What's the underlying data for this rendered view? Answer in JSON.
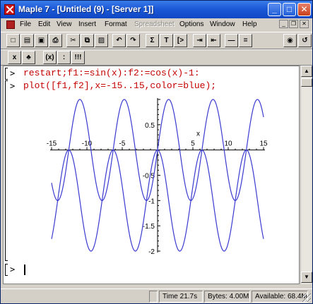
{
  "window": {
    "title": "Maple 7 - [Untitled (9) - [Server 1]]"
  },
  "menu": [
    {
      "label": "File",
      "disabled": false
    },
    {
      "label": "Edit",
      "disabled": false
    },
    {
      "label": "View",
      "disabled": false
    },
    {
      "label": "Insert",
      "disabled": false
    },
    {
      "label": "Format",
      "disabled": false
    },
    {
      "label": "Spreadsheet",
      "disabled": true
    },
    {
      "label": "Options",
      "disabled": false
    },
    {
      "label": "Window",
      "disabled": false
    },
    {
      "label": "Help",
      "disabled": false
    }
  ],
  "toolbar1": [
    {
      "name": "new-document-icon",
      "glyph": "□"
    },
    {
      "name": "open-folder-icon",
      "glyph": "▤"
    },
    {
      "name": "save-icon",
      "glyph": "▣"
    },
    {
      "name": "print-icon",
      "glyph": "⎙"
    },
    {
      "name": "cut-icon",
      "glyph": "✂"
    },
    {
      "name": "copy-icon",
      "glyph": "⧉"
    },
    {
      "name": "paste-icon",
      "glyph": "▨"
    },
    {
      "name": "undo-icon",
      "glyph": "↶"
    },
    {
      "name": "redo-icon",
      "glyph": "↷"
    },
    {
      "name": "math-input-icon",
      "glyph": "Σ"
    },
    {
      "name": "text-input-icon",
      "glyph": "T"
    },
    {
      "name": "insert-prompt-icon",
      "glyph": "[>"
    },
    {
      "name": "section-indent-icon",
      "glyph": "⇥"
    },
    {
      "name": "section-outdent-icon",
      "glyph": "⇤"
    },
    {
      "name": "zoom-in-icon",
      "glyph": "—"
    },
    {
      "name": "zoom-out-icon",
      "glyph": "="
    },
    {
      "name": "stop-icon",
      "glyph": "◉"
    },
    {
      "name": "restart-icon",
      "glyph": "↺"
    }
  ],
  "toolbar2": [
    {
      "name": "execute-icon",
      "glyph": "x"
    },
    {
      "name": "debug-icon",
      "glyph": "♣"
    },
    {
      "name": "expression-icon",
      "glyph": "(x)"
    },
    {
      "name": "colon-icon",
      "glyph": ":"
    },
    {
      "name": "execute-all-icon",
      "glyph": "!!!"
    }
  ],
  "worksheet": {
    "prompt_symbol": ">",
    "commands": [
      "restart;f1:=sin(x):f2:=cos(x)-1:",
      "plot([f1,f2],x=-15..15,color=blue);"
    ]
  },
  "chart_data": {
    "type": "line",
    "series": [
      {
        "expression": "sin(x)",
        "color": "#3a3ad0"
      },
      {
        "expression": "cos(x)-1",
        "color": "#3a3ad0"
      }
    ],
    "xlim": [
      -15,
      15
    ],
    "ylim": [
      -2,
      1
    ],
    "xlabel": "x",
    "x_ticks": [
      {
        "value": -15,
        "label": "-15"
      },
      {
        "value": -10,
        "label": "-10"
      },
      {
        "value": -5,
        "label": "-5"
      },
      {
        "value": 5,
        "label": "5"
      },
      {
        "value": 10,
        "label": "10"
      },
      {
        "value": 15,
        "label": "15"
      }
    ],
    "y_ticks": [
      {
        "value": 0.5,
        "label": "0.5"
      },
      {
        "value": -0.5,
        "label": "-0.5"
      },
      {
        "value": -1,
        "label": "-1"
      },
      {
        "value": -1.5,
        "label": "-1.5"
      },
      {
        "value": -2,
        "label": "-2"
      }
    ],
    "grid": false
  },
  "status": {
    "time": "Time  21.7s",
    "bytes": "Bytes: 4.00M",
    "available": "Available: 68.4M"
  }
}
